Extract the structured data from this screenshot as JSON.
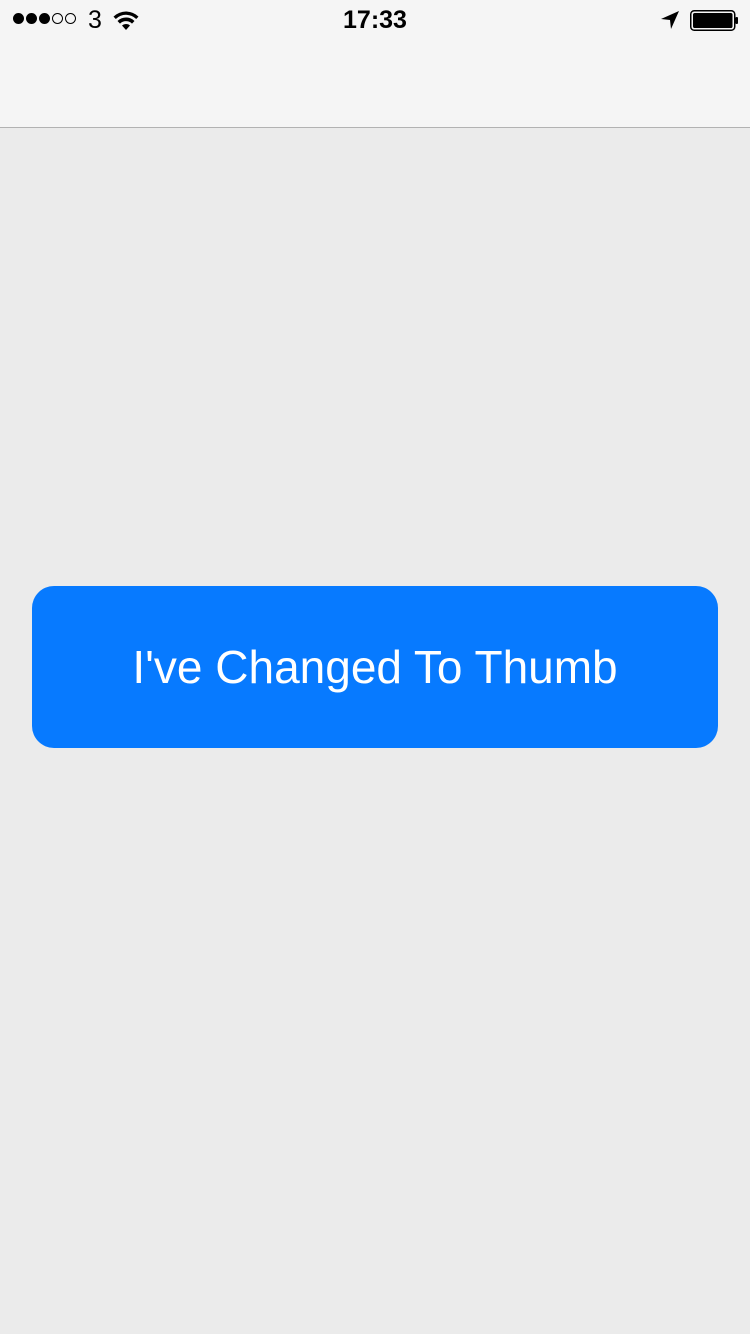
{
  "status_bar": {
    "signal_bars_filled": 3,
    "signal_bars_total": 5,
    "carrier": "3",
    "wifi_icon": "wifi-icon",
    "time": "17:33",
    "location_icon": "location-arrow-icon",
    "battery_icon": "battery-icon",
    "battery_level": 1.0
  },
  "nav_bar": {
    "title": ""
  },
  "main": {
    "button_label": "I've Changed To Thumb"
  },
  "colors": {
    "background": "#ebebeb",
    "nav_background": "#f5f5f5",
    "button": "#077aff",
    "button_text": "#ffffff"
  }
}
